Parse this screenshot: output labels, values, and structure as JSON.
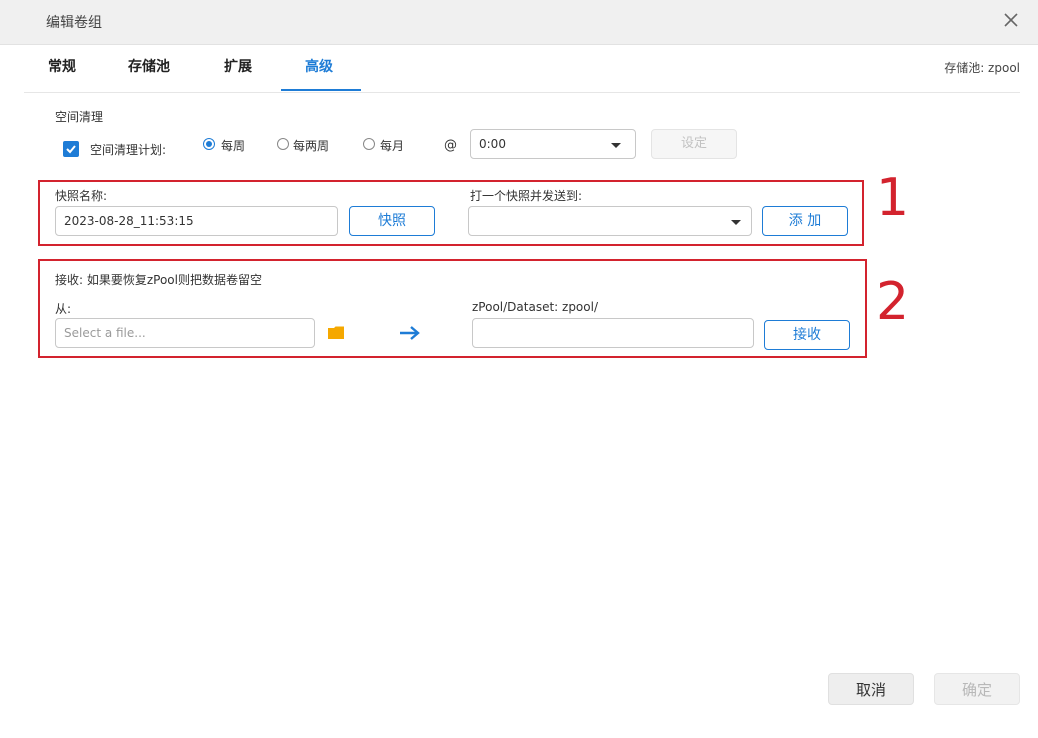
{
  "window": {
    "title": "编辑卷组"
  },
  "tabs": [
    {
      "label": "常规"
    },
    {
      "label": "存储池"
    },
    {
      "label": "扩展"
    },
    {
      "label": "高级"
    }
  ],
  "pool_label": "存储池: zpool",
  "trim": {
    "section_label": "空间清理",
    "schedule_label": "空间清理计划:",
    "schedule_checked": true,
    "options": [
      "每周",
      "每两周",
      "每月"
    ],
    "selected": "每周",
    "at_symbol": "@",
    "time_value": "0:00",
    "set_button": "设定"
  },
  "snapshot": {
    "name_label": "快照名称:",
    "name_value": "2023-08-28_11:53:15",
    "snapshot_button": "快照",
    "send_label": "打一个快照并发送到:",
    "send_value": "",
    "add_button": "添 加"
  },
  "receive": {
    "hint": "接收: 如果要恢复zPool则把数据卷留空",
    "from_label": "从:",
    "file_placeholder": "Select a file...",
    "dataset_label": "zPool/Dataset: zpool/",
    "dataset_value": "",
    "receive_button": "接收"
  },
  "annotations": {
    "box1": "1",
    "box2": "2"
  },
  "footer": {
    "cancel": "取消",
    "ok": "确定"
  },
  "colors": {
    "accent": "#1e7cd6",
    "annotation_red": "#d3232e",
    "folder": "#f5a800"
  }
}
